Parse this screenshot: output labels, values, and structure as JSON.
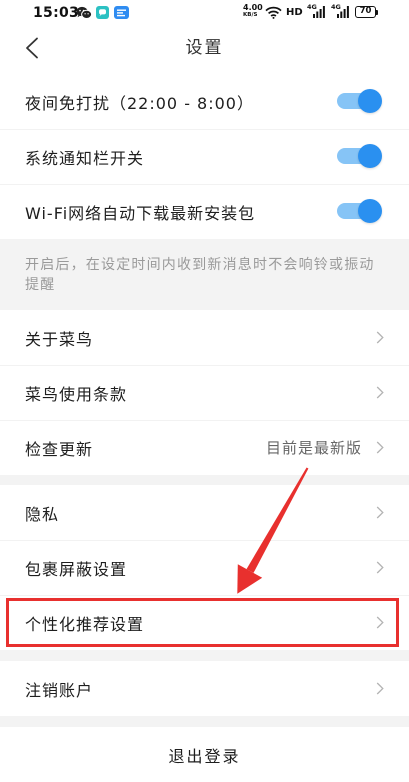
{
  "status_bar": {
    "time": "15:03",
    "net_speed": {
      "value": "4.00",
      "unit": "KB/S"
    },
    "hd_label": "HD",
    "sim1_network": "4G",
    "sim2_network": "4G",
    "battery_level": "70",
    "icons": {
      "wechat": "wechat-icon",
      "app_a": "chat-app-icon",
      "app_b": "express-app-icon",
      "wifi": "wifi-icon",
      "signal": "signal-bars-icon",
      "battery": "battery-icon"
    }
  },
  "header": {
    "title": "设置",
    "back_icon": "chevron-left-icon"
  },
  "toggles": [
    {
      "label": "夜间免打扰（22:00 - 8:00）",
      "on": true
    },
    {
      "label": "系统通知栏开关",
      "on": true
    },
    {
      "label": "Wi-Fi网络自动下载最新安装包",
      "on": true
    }
  ],
  "toggle_note": "开启后，在设定时间内收到新消息时不会响铃或振动提醒",
  "group1": [
    {
      "label": "关于菜鸟"
    },
    {
      "label": "菜鸟使用条款"
    },
    {
      "label": "检查更新",
      "value": "目前是最新版"
    }
  ],
  "group2": [
    {
      "label": "隐私"
    },
    {
      "label": "包裹屏蔽设置"
    },
    {
      "label": "个性化推荐设置",
      "highlighted": true
    }
  ],
  "group3": [
    {
      "label": "注销账户"
    }
  ],
  "logout_label": "退出登录",
  "row_icon": "chevron-right-icon",
  "colors": {
    "accent": "#2a90f0",
    "toggle_track": "#86c4f6",
    "annotation_red": "#e8302e",
    "section_bg": "#f3f3f3",
    "note_text": "#9a9a9a",
    "chevron": "#b3b3b3"
  }
}
